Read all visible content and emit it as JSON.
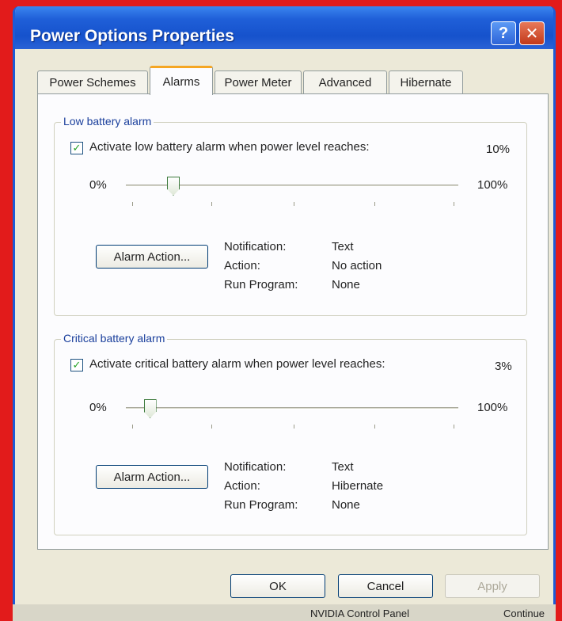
{
  "window": {
    "title": "Power Options Properties",
    "help_label": "?",
    "close_label": "✕"
  },
  "tabs": [
    {
      "label": "Power Schemes",
      "active": false
    },
    {
      "label": "Alarms",
      "active": true
    },
    {
      "label": "Power Meter",
      "active": false
    },
    {
      "label": "Advanced",
      "active": false
    },
    {
      "label": "Hibernate",
      "active": false
    }
  ],
  "low_alarm": {
    "group_label": "Low battery alarm",
    "checkbox_label": "Activate low battery alarm when power level reaches:",
    "checked": true,
    "value_label": "10%",
    "level_percent": 10,
    "min_label": "0%",
    "max_label": "100%",
    "action_button": "Alarm Action...",
    "info": {
      "notification_label": "Notification:",
      "notification_value": "Text",
      "action_label": "Action:",
      "action_value": "No action",
      "run_program_label": "Run Program:",
      "run_program_value": "None"
    }
  },
  "critical_alarm": {
    "group_label": "Critical battery alarm",
    "checkbox_label": "Activate critical battery alarm when power level reaches:",
    "checked": true,
    "value_label": "3%",
    "level_percent": 3,
    "min_label": "0%",
    "max_label": "100%",
    "action_button": "Alarm Action...",
    "info": {
      "notification_label": "Notification:",
      "notification_value": "Text",
      "action_label": "Action:",
      "action_value": "Hibernate",
      "run_program_label": "Run Program:",
      "run_program_value": "None"
    }
  },
  "footer": {
    "ok_label": "OK",
    "cancel_label": "Cancel",
    "apply_label": "Apply"
  },
  "background": {
    "taskbar_item": "NVIDIA Control Panel",
    "taskbar_item2": "Continue"
  },
  "colors": {
    "accent": "#1d5bd6",
    "frame": "#e21b1b",
    "check": "#21a121"
  }
}
